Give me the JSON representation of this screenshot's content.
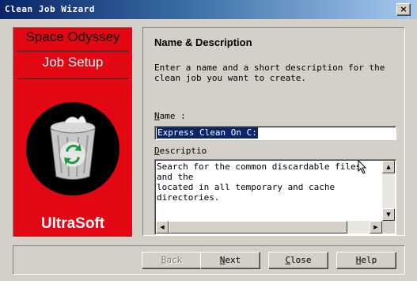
{
  "window": {
    "title": "Clean Job Wizard",
    "close_glyph": "×"
  },
  "banner": {
    "product": "Space Odyssey",
    "subtitle": "Job Setup",
    "brand": "UltraSoft",
    "icon": "recycle-bin-icon",
    "colors": {
      "background": "#e30613",
      "badge": "#000000"
    }
  },
  "panel": {
    "heading": "Name & Description",
    "description": "Enter a name and a short description for the clean job you want to create.",
    "name_label_key": "N",
    "name_label_rest": "ame :",
    "name_value": "Express Clean On C:",
    "desc_label_key": "D",
    "desc_label_rest": "escriptio",
    "desc_value": "Search for the common discardable files and the\nlocated in all temporary and cache directories."
  },
  "scroll": {
    "up": "▲",
    "down": "▼",
    "left": "◀",
    "right": "▶"
  },
  "buttons": {
    "back_key": "B",
    "back_rest": "ack",
    "next_key": "N",
    "next_rest": "ext",
    "close_key": "C",
    "close_rest": "lose",
    "help_key": "H",
    "help_rest": "elp"
  },
  "colors": {
    "selection": "#0a246a",
    "window": "#d4d0c8",
    "title_start": "#0a246a"
  }
}
